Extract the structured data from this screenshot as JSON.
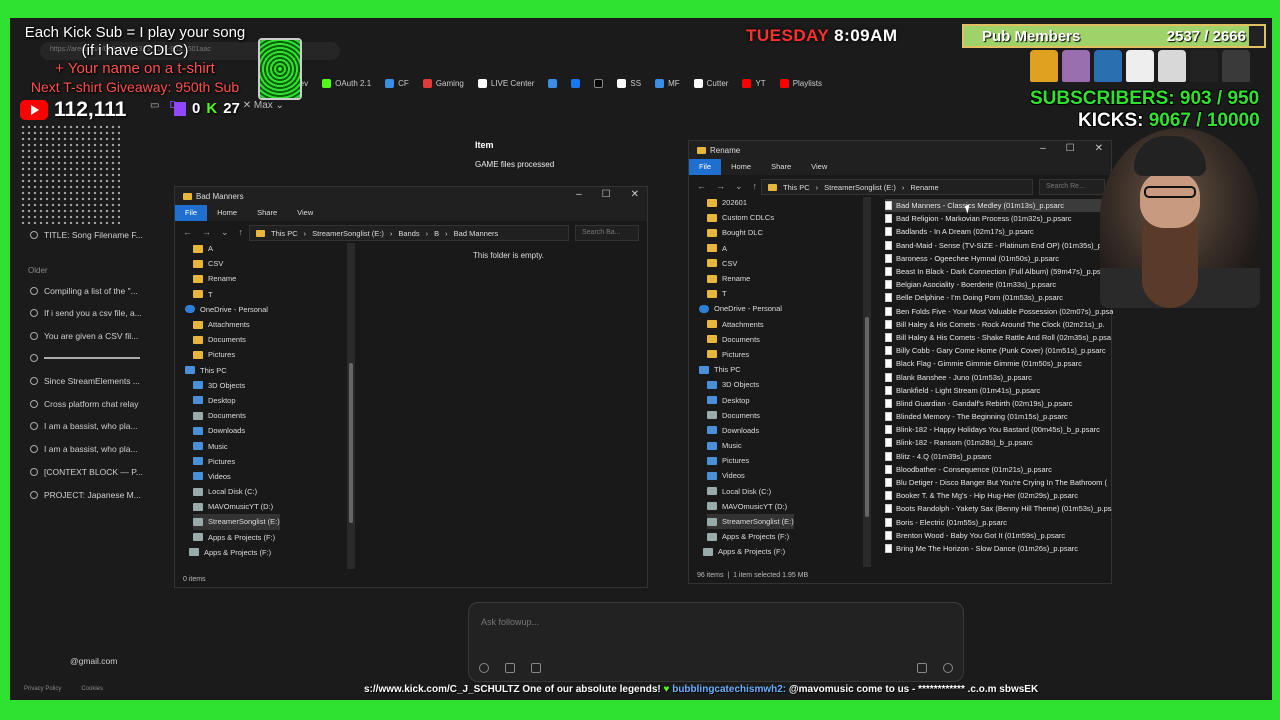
{
  "overlay": {
    "kick_sub_line1": "Each Kick Sub = I play your song",
    "kick_sub_line2": "(if i have CDLC)",
    "name_shirt": "+ Your name on a t-shirt",
    "giveaway": "Next T-shirt Giveaway: 950th Sub",
    "yt_count": "112,111",
    "twitch_count": "0",
    "kick_count": "27",
    "day": "TUESDAY",
    "time": "8:09AM",
    "pub_label": "Pub Members",
    "pub_count": "2537 / 2666",
    "pub_progress": 0.95,
    "subscribers_label": "SUBSCRIBERS:",
    "subscribers_value": "903 / 950",
    "kicks_label": "KICKS:",
    "kicks_value": "9067 / 10000",
    "ticker_a": "s://www.kick.com/C_J_SCHULTZ One of our absolute legends! ",
    "ticker_b": "bubblingcatechismwh2:",
    "ticker_c": " @mavomusic come to us - ************ .c.o.m sbwsEK"
  },
  "browser": {
    "url": "https://arena.ai/c/019c0c4f-5313-7106-9d3...501aac",
    "bookmarks": [
      "KICK Dev",
      "OAuth 2.1",
      "CF",
      "Gaming",
      "LIVE Center",
      "",
      "",
      "SS",
      "MF",
      "Cutter",
      "YT",
      "Playlists"
    ],
    "tab_user": "Max",
    "tab_d": "D"
  },
  "sidebar": {
    "items_top": [
      "TITLE: Song Filename F..."
    ],
    "older_label": "Older",
    "items": [
      "Compiling a list of the \"...",
      "If i send you a csv file, a...",
      "You are given a CSV fil...",
      "",
      "Since StreamElements ...",
      "Cross platform chat relay",
      "I am a bassist, who pla...",
      "I am a bassist, who pla...",
      "[CONTEXT BLOCK — P...",
      "PROJECT: Japanese M..."
    ],
    "email": "@gmail.com",
    "footer": [
      "Privacy Policy",
      "Cookies"
    ]
  },
  "chat": {
    "item_label": "Item",
    "games_processed": "GAME files processed",
    "followup_placeholder": "Ask followup..."
  },
  "left_explorer": {
    "title": "Bad Manners",
    "ribbon": [
      "File",
      "Home",
      "Share",
      "View"
    ],
    "path": [
      "This PC",
      "StreamerSonglist (E:)",
      "Bands",
      "B",
      "Bad Manners"
    ],
    "search_placeholder": "Search Ba...",
    "empty_text": "This folder is empty.",
    "tree": [
      "A",
      "CSV",
      "Rename",
      "T",
      "OneDrive - Personal",
      "Attachments",
      "Documents",
      "Pictures",
      "This PC",
      "3D Objects",
      "Desktop",
      "Documents",
      "Downloads",
      "Music",
      "Pictures",
      "Videos",
      "Local Disk (C:)",
      "MAVOmusicYT (D:)",
      "StreamerSonglist (E:)",
      "Apps & Projects (F:)",
      "Apps & Projects (F:)"
    ],
    "status": "0 items"
  },
  "right_explorer": {
    "title": "Rename",
    "ribbon": [
      "File",
      "Home",
      "Share",
      "View"
    ],
    "path": [
      "This PC",
      "StreamerSonglist (E:)",
      "Rename"
    ],
    "search_placeholder": "Search Re...",
    "tree": [
      "202601",
      "Custom CDLCs",
      "Bought DLC",
      "A",
      "CSV",
      "Rename",
      "T",
      "OneDrive - Personal",
      "Attachments",
      "Documents",
      "Pictures",
      "This PC",
      "3D Objects",
      "Desktop",
      "Documents",
      "Downloads",
      "Music",
      "Pictures",
      "Videos",
      "Local Disk (C:)",
      "MAVOmusicYT (D:)",
      "StreamerSonglist (E:)",
      "Apps & Projects (F:)",
      "Apps & Projects (F:)"
    ],
    "files": [
      "Bad Manners - Classics Medley (01m13s)_p.psarc",
      "Bad Religion - Markovian Process (01m32s)_p.psarc",
      "Badlands - In A Dream (02m17s)_p.psarc",
      "Band-Maid - Sense (TV-SIZE - Platinum End OP) (01m35s)_p.",
      "Baroness - Ogeechee Hymnal (01m50s)_p.psarc",
      "Beast In Black - Dark Connection (Full Album) (59m47s)_p.psarc",
      "Belgian Asociality - Boerderie (01m33s)_p.psarc",
      "Belle Delphine - I'm Doing Porn (01m53s)_p.psarc",
      "Ben Folds Five - Your Most Valuable Possession (02m07s)_p.psa",
      "Bill Haley & His Comets - Rock Around The Clock (02m21s)_p.",
      "Bill Haley & His Comets - Shake Rattle And Roll (02m35s)_p.psa",
      "Billy Cobb - Gary Come Home (Punk Cover) (01m51s)_p.psarc",
      "Black Flag - Gimmie Gimmie Gimmie (01m50s)_p.psarc",
      "Blank Banshee - Juno (01m53s)_p.psarc",
      "Blankfield - Light Stream (01m41s)_p.psarc",
      "Blind Guardian - Gandalf's Rebirth (02m19s)_p.psarc",
      "Blinded Memory - The Beginning (01m15s)_p.psarc",
      "Blink-182 - Happy Holidays You Bastard (00m45s)_b_p.psarc",
      "Blink-182 - Ransom (01m28s)_b_p.psarc",
      "Blitz - 4.Q (01m39s)_p.psarc",
      "Bloodbather - Consequence (01m21s)_p.psarc",
      "Blu Detiger - Disco Banger But You're Crying In The Bathroom (",
      "Booker T. & The Mg's - Hip Hug-Her (02m29s)_p.psarc",
      "Boots Randolph - Yakety Sax (Benny Hill Theme) (01m53s)_p.ps",
      "Boris - Electric (01m55s)_p.psarc",
      "Brenton Wood - Baby You Got It (01m59s)_p.psarc",
      "Bring Me The Horizon - Slow Dance (01m26s)_p.psarc"
    ],
    "status_items": "96 items",
    "status_selected": "1 item selected  1.95 MB"
  },
  "colors": {
    "green_screen": "#2fe22f",
    "explorer_bg": "#191919",
    "ribbon_file": "#1f6fd1",
    "kick_green": "#53fc18"
  }
}
